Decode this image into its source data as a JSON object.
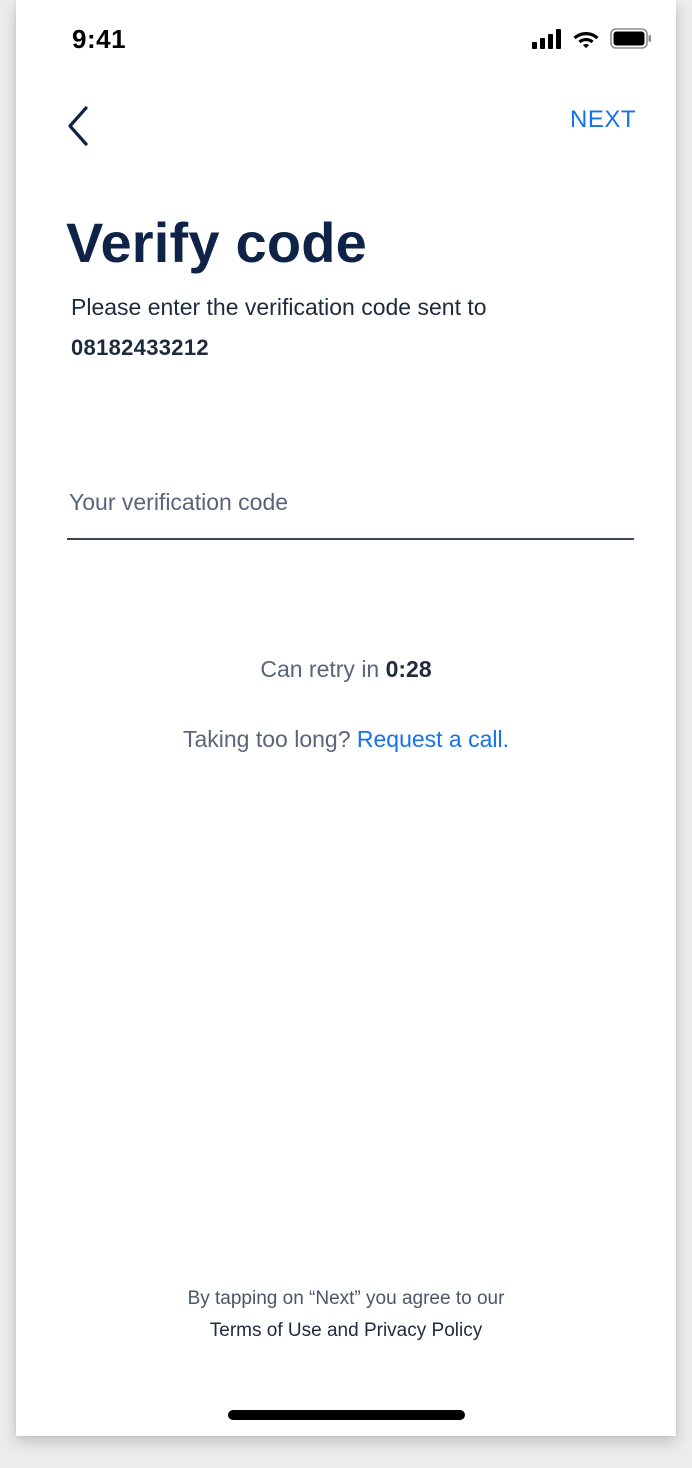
{
  "status_bar": {
    "time": "9:41",
    "icons": [
      "cellular-signal-icon",
      "wifi-icon",
      "battery-icon"
    ]
  },
  "nav": {
    "back_icon": "chevron-left-icon",
    "next_label": "NEXT"
  },
  "header": {
    "title": "Verify code",
    "subtitle": "Please enter the verification code sent to",
    "phone_number": "08182433212"
  },
  "form": {
    "code_placeholder": "Your verification code",
    "code_value": ""
  },
  "retry": {
    "prefix": "Can retry in ",
    "timer": "0:28"
  },
  "call": {
    "prefix": "Taking too long? ",
    "link_label": "Request a call."
  },
  "legal": {
    "line1": "By tapping on “Next” you agree to our",
    "line2": "Terms of Use and Privacy Policy"
  },
  "colors": {
    "accent": "#1672e8",
    "title": "#0e2347",
    "text": "#1e2b3c",
    "muted": "#5a6678"
  }
}
